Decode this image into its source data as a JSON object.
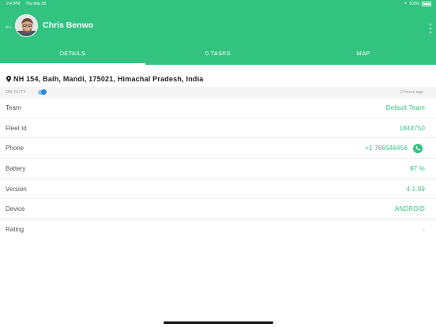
{
  "status_bar": {
    "time": "9:47PM",
    "date": "Thu Mar 28",
    "battery": "100%"
  },
  "header": {
    "driver_name": "Chris Benwo"
  },
  "tabs": [
    {
      "label": "DETAILS",
      "active": true
    },
    {
      "label": "0 TASKS",
      "active": false
    },
    {
      "label": "MAP",
      "active": false
    }
  ],
  "address": "NH 154, Balh, Mandi, 175021, Himachal Pradesh, India",
  "duty": {
    "label": "ON DUTY",
    "on": true,
    "updated": "2 hours ago"
  },
  "details": [
    {
      "label": "Team",
      "value": "Default Team"
    },
    {
      "label": "Fleet Id",
      "value": "1844750"
    },
    {
      "label": "Phone",
      "value": "+1 786546456"
    },
    {
      "label": "Battery",
      "value": "97 %"
    },
    {
      "label": "Version",
      "value": "4.1.99"
    },
    {
      "label": "Device",
      "value": "ANDROID"
    },
    {
      "label": "Rating",
      "value": "-"
    }
  ],
  "colors": {
    "brand_green": "#33c380",
    "toggle_blue": "#2e88d8"
  }
}
